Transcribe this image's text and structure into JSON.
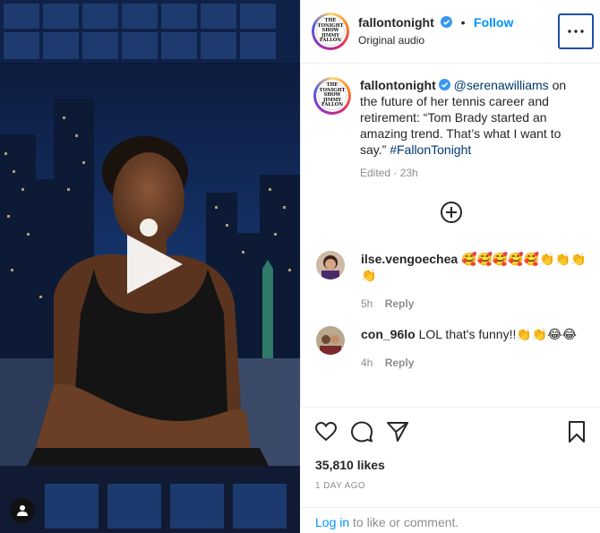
{
  "post": {
    "username": "fallontonight",
    "follow_label": "Follow",
    "dot": "•",
    "audio": "Original audio",
    "logo_lines": [
      "THE",
      "TONIGHT",
      "SHOW",
      "JIMMY",
      "FALLON"
    ]
  },
  "caption": {
    "username": "fallontonight",
    "mention": "@serenawilliams",
    "text": " on the future of her tennis career and retirement: “Tom Brady started an amazing trend. That’s what I want to say.” ",
    "hashtag": "#FallonTonight",
    "edited": "Edited · 23h"
  },
  "comments": [
    {
      "username": "ilse.vengoechea",
      "text": "🥰🥰🥰🥰🥰👏👏👏👏",
      "time": "5h",
      "reply_label": "Reply"
    },
    {
      "username": "con_96lo",
      "text": "LOL that's funny!!👏👏😂😂",
      "time": "4h",
      "reply_label": "Reply"
    }
  ],
  "actions": {
    "likes": "35,810 likes",
    "date": "1 DAY AGO",
    "login_label": "Log in",
    "login_suffix": " to like or comment."
  },
  "colors": {
    "follow_blue": "#0095f6",
    "link_blue": "#00376b",
    "muted": "#8e8e8e"
  }
}
